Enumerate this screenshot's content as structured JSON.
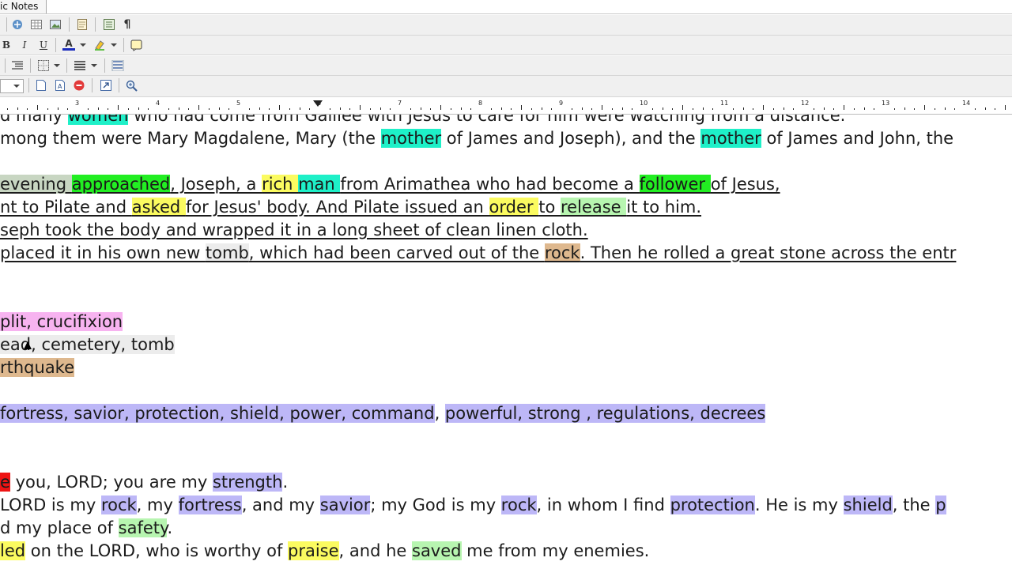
{
  "tab": {
    "label": "ic Notes"
  },
  "toolbar": {
    "format_bold": "B",
    "format_italic": "I",
    "format_underline": "U",
    "font_color": "A",
    "pilcrow": "¶"
  },
  "ruler": {
    "numbers": [
      "3",
      "4",
      "5",
      "6",
      "7",
      "8",
      "9",
      "10",
      "11",
      "12",
      "13",
      "14"
    ]
  },
  "editor": {
    "line0": {
      "segments": [
        {
          "text": "d many ",
          "hl": ""
        },
        {
          "text": "women",
          "hl": "h-cyan"
        },
        {
          "text": " who had come from Galilee with Jesus to care for him were watching from a distance.",
          "hl": ""
        }
      ]
    },
    "line1": {
      "segments": [
        {
          "text": "mong them were Mary Magdalene, Mary (the ",
          "hl": ""
        },
        {
          "text": "mother",
          "hl": "h-cyan"
        },
        {
          "text": " of James and Joseph), and the ",
          "hl": ""
        },
        {
          "text": "mother",
          "hl": "h-cyan"
        },
        {
          "text": " of James and John, the",
          "hl": ""
        }
      ]
    },
    "line2": {
      "segments": [
        {
          "text": " evening ",
          "hl": "h-grey2"
        },
        {
          "text": "approached",
          "hl": "h-green"
        },
        {
          "text": ", Joseph, a ",
          "hl": ""
        },
        {
          "text": "rich ",
          "hl": "h-yellow"
        },
        {
          "text": "man ",
          "hl": "h-cyan"
        },
        {
          "text": "from Arimathea who had become a ",
          "hl": ""
        },
        {
          "text": "follower ",
          "hl": "h-green"
        },
        {
          "text": "of Jesus, ",
          "hl": ""
        }
      ]
    },
    "line3": {
      "segments": [
        {
          "text": "nt to Pilate and ",
          "hl": ""
        },
        {
          "text": "asked ",
          "hl": "h-yellow"
        },
        {
          "text": "for Jesus' body. And Pilate issued an ",
          "hl": ""
        },
        {
          "text": "order ",
          "hl": "h-yellow"
        },
        {
          "text": "to ",
          "hl": ""
        },
        {
          "text": "release ",
          "hl": "h-lightgreen"
        },
        {
          "text": "it to him. ",
          "hl": ""
        }
      ]
    },
    "line4": {
      "segments": [
        {
          "text": "seph took the body and wrapped it in a long sheet of clean linen cloth. ",
          "hl": ""
        }
      ]
    },
    "line5": {
      "segments": [
        {
          "text": " placed it in his own new ",
          "hl": ""
        },
        {
          "text": "tomb",
          "hl": "h-gray"
        },
        {
          "text": ", which had been carved out of the ",
          "hl": ""
        },
        {
          "text": "rock",
          "hl": "h-tan"
        },
        {
          "text": ". Then he rolled a great stone across the entr",
          "hl": ""
        }
      ]
    },
    "line6": {
      "segments": [
        {
          "text": "plit, crucifixion   ",
          "hl": "h-pink"
        }
      ]
    },
    "line7": {
      "segments": [
        {
          "text": "ead, cemetery, tomb   ",
          "hl": "h-gray"
        }
      ]
    },
    "line8": {
      "segments": [
        {
          "text": "rthquake   ",
          "hl": "h-tan"
        }
      ]
    },
    "line9": {
      "segments": [
        {
          "text": " fortress, savior, protection, shield, power, command",
          "hl": "h-violet"
        },
        {
          "text": ", ",
          "hl": ""
        },
        {
          "text": "powerful, strong , regulations, decrees  ",
          "hl": "h-violet"
        }
      ]
    },
    "line10": {
      "segments": [
        {
          "text": "e",
          "hl": "h-red"
        },
        {
          "text": " you, LORD; you are my ",
          "hl": ""
        },
        {
          "text": "strength",
          "hl": "h-violet"
        },
        {
          "text": ".",
          "hl": ""
        }
      ]
    },
    "line11": {
      "segments": [
        {
          "text": " LORD is my ",
          "hl": ""
        },
        {
          "text": "rock",
          "hl": "h-violet"
        },
        {
          "text": ", my ",
          "hl": ""
        },
        {
          "text": "fortress",
          "hl": "h-violet"
        },
        {
          "text": ", and my ",
          "hl": ""
        },
        {
          "text": "savior",
          "hl": "h-violet"
        },
        {
          "text": "; my God is my ",
          "hl": ""
        },
        {
          "text": "rock",
          "hl": "h-violet"
        },
        {
          "text": ", in whom I find ",
          "hl": ""
        },
        {
          "text": "protection",
          "hl": "h-violet"
        },
        {
          "text": ". He is my ",
          "hl": ""
        },
        {
          "text": "shield",
          "hl": "h-violet"
        },
        {
          "text": ", the ",
          "hl": ""
        },
        {
          "text": "p",
          "hl": "h-violet"
        }
      ]
    },
    "line12": {
      "segments": [
        {
          "text": "d my place of ",
          "hl": ""
        },
        {
          "text": "safety",
          "hl": "h-lightgreen"
        },
        {
          "text": ".",
          "hl": ""
        }
      ]
    },
    "line13": {
      "segments": [
        {
          "text": "led",
          "hl": "h-yellow"
        },
        {
          "text": " on the LORD, who is worthy of ",
          "hl": ""
        },
        {
          "text": "praise",
          "hl": "h-yellow"
        },
        {
          "text": ", and he ",
          "hl": ""
        },
        {
          "text": "saved",
          "hl": "h-lightgreen"
        },
        {
          "text": " me from my enemies.",
          "hl": ""
        }
      ]
    }
  }
}
